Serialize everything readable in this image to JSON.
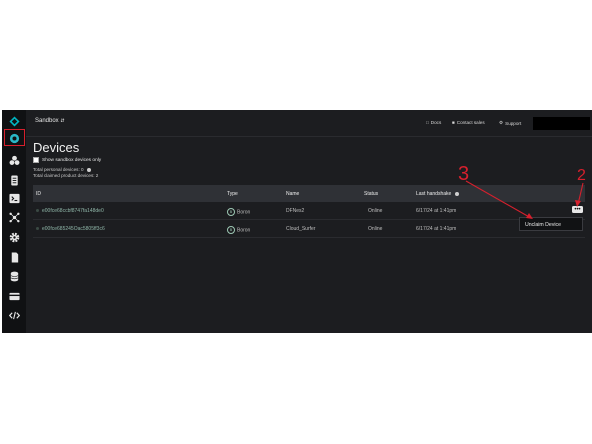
{
  "topbar": {
    "org_name": "Sandbox",
    "docs_label": "Docs",
    "contact_label": "Contact sales",
    "support_label": "Support"
  },
  "sidebar": {
    "items": [
      {
        "icon": "particle-logo-icon"
      },
      {
        "icon": "devices-icon",
        "active": true
      },
      {
        "icon": "products-icon"
      },
      {
        "icon": "billing-icon"
      },
      {
        "icon": "console-icon"
      },
      {
        "icon": "integrations-icon"
      },
      {
        "icon": "settings-icon"
      },
      {
        "icon": "sim-card-icon"
      },
      {
        "icon": "database-icon"
      },
      {
        "icon": "card-icon"
      },
      {
        "icon": "code-icon"
      }
    ]
  },
  "page": {
    "title": "Devices",
    "sandbox_checkbox_label": "Show sandbox devices only",
    "total_personal": "Total personal devices: 0",
    "total_claimed": "Total claimed product devices: 2"
  },
  "table": {
    "headers": {
      "id": "ID",
      "type": "Type",
      "name": "Name",
      "status": "Status",
      "handshake": "Last handshake"
    },
    "rows": [
      {
        "id": "e00fce68ccbf8747fa148de0",
        "type": "Boron",
        "type_badge": "B",
        "name": "DFNes2",
        "status": "Online",
        "handshake": "6/17/24 at 1:41pm"
      },
      {
        "id": "e00fce685245Oac5805ff3c6",
        "type": "Boron",
        "type_badge": "B",
        "name": "Cloud_Surfer",
        "status": "Online",
        "handshake": "6/17/24 at 1:41pm"
      }
    ]
  },
  "row_menu": {
    "more_label": "•••",
    "unclaim_label": "Unclaim Device"
  },
  "annotations": {
    "label_1": "3",
    "label_2": "2",
    "color": "#d6202d"
  }
}
